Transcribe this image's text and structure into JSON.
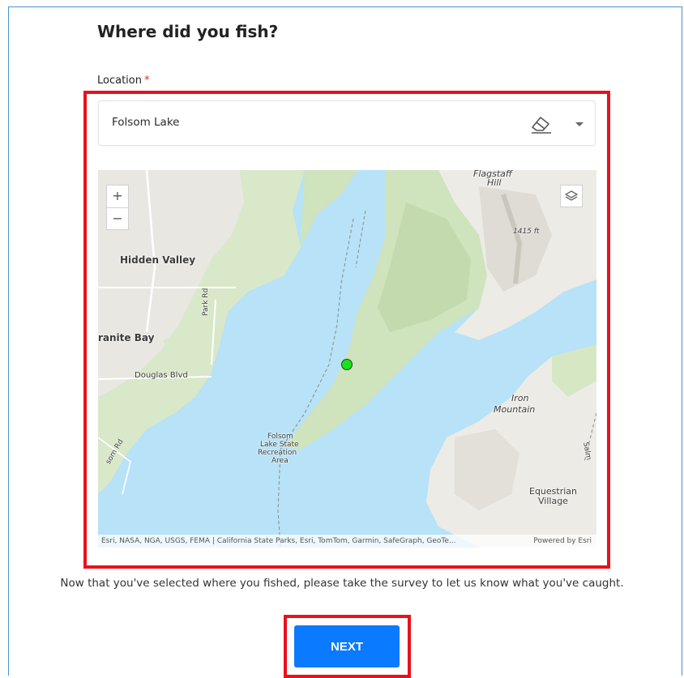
{
  "page": {
    "heading": "Where did you fish?",
    "note": "Now that you've selected where you fished, please take the survey to let us know what you've caught."
  },
  "location_field": {
    "label": "Location",
    "required_mark": "*",
    "selected_value": "Folsom Lake",
    "clear_icon": "eraser-icon",
    "dropdown_icon": "chevron-down-icon"
  },
  "map": {
    "zoom_in": "+",
    "zoom_out": "−",
    "layers_icon": "layers-icon",
    "labels": {
      "flagstaff": "Flagstaff",
      "hill": "Hill",
      "elev": "1415 ft",
      "hidden_valley": "Hidden Valley",
      "granite_bay": "ranite Bay",
      "park_rd": "Park Rd",
      "douglas": "Douglas Blvd",
      "iron": "Iron",
      "mountain": "Mountain",
      "recreation1": "Folsom",
      "recreation2": "Lake State",
      "recreation3": "Recreation",
      "recreation4": "Area",
      "equestrian1": "Equestrian",
      "equestrian2": "Village",
      "folsom_rd": "som Rd",
      "salmon": "Salm"
    },
    "attribution": "Esri, NASA, NGA, USGS, FEMA | California State Parks, Esri, TomTom, Garmin, SafeGraph, GeoTe...",
    "powered_by": "Powered by Esri",
    "marker_color": "#19e319"
  },
  "actions": {
    "next_label": "NEXT"
  },
  "colors": {
    "highlight": "#e8111c",
    "button": "#0a7aff",
    "water": "#b7e2f7",
    "land": "#d6e7c4",
    "hills": "#ecebe6"
  }
}
